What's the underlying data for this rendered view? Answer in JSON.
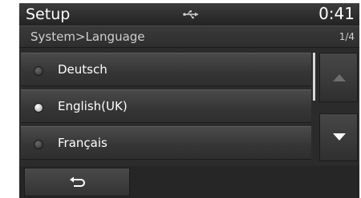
{
  "header": {
    "title": "Setup",
    "usb_icon": "usb-icon",
    "time": "0:41"
  },
  "pathbar": {
    "path": "System>Language",
    "page": "1/4"
  },
  "languages": [
    {
      "label": "Deutsch",
      "selected": false
    },
    {
      "label": "English(UK)",
      "selected": true
    },
    {
      "label": "Français",
      "selected": false
    }
  ],
  "scroll": {
    "up_icon": "triangle-up-icon",
    "down_icon": "triangle-down-icon"
  },
  "bottom": {
    "back_icon": "back-arrow-icon"
  },
  "colors": {
    "background": "#2b2b2b",
    "text": "#ffffff",
    "disabled_arrow": "#6e6e6e"
  }
}
